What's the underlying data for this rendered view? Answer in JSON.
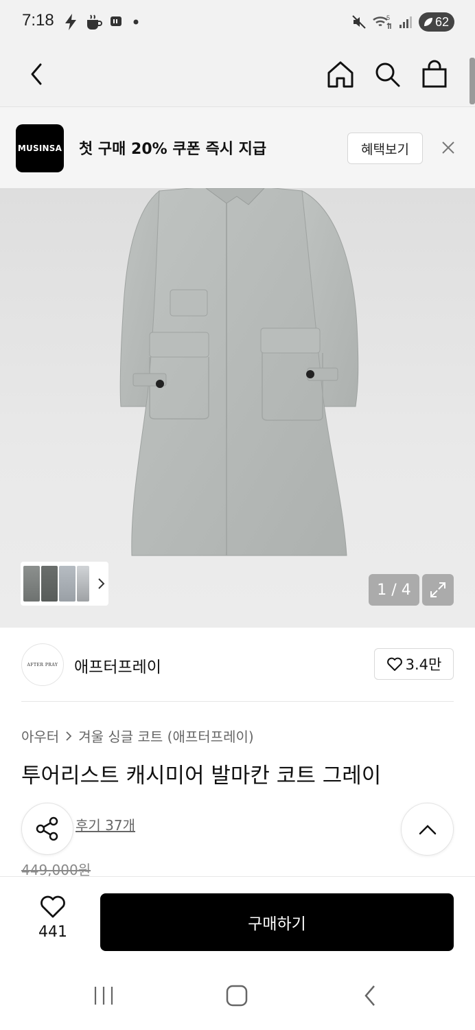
{
  "status_bar": {
    "time": "7:18",
    "battery": "62",
    "left_icons": [
      "flash-icon",
      "coffee-icon",
      "message-icon",
      "dot-icon"
    ],
    "right_icons": [
      "mute-icon",
      "wifi-icon",
      "signal-icon",
      "battery-icon"
    ]
  },
  "top_nav": {
    "back_icon": "back-arrow-icon",
    "home_icon": "home-icon",
    "search_icon": "search-icon",
    "cart_icon": "shopping-bag-icon"
  },
  "promo": {
    "logo_text": "MUSINSA",
    "message": "첫 구매 20% 쿠폰 즉시 지급",
    "benefit_button": "혜택보기"
  },
  "gallery": {
    "counter": "1 / 4"
  },
  "brand": {
    "logo_text": "AFTER PRAY",
    "name": "애프터프레이",
    "likes": "3.4만"
  },
  "product": {
    "breadcrumb": [
      "아우터",
      "겨울 싱글 코트 (애프터프레이)"
    ],
    "title": "투어리스트 캐시미어 발마칸 코트 그레이",
    "reviews_label": "후기 37개",
    "original_price": "449,000원"
  },
  "purchase_bar": {
    "wish_count": "441",
    "buy_label": "구매하기"
  },
  "colors": {
    "buy_button": "#000000",
    "accent": "#111111"
  }
}
